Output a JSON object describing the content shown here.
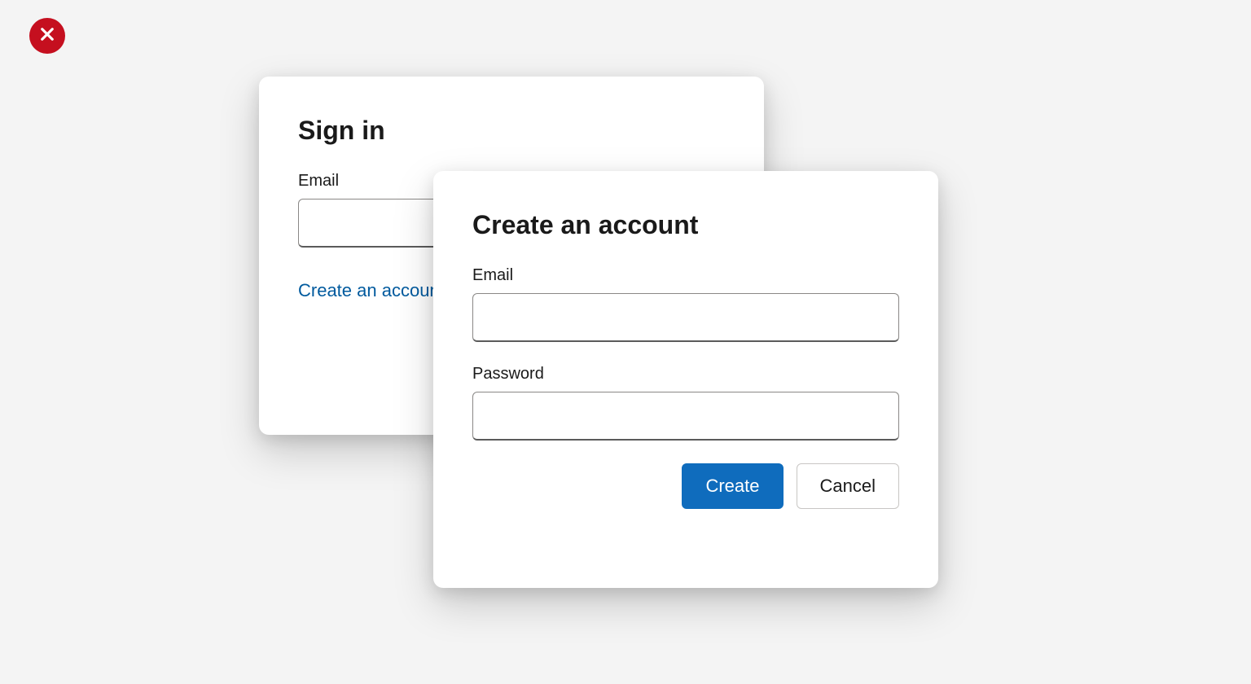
{
  "error_badge": {
    "icon": "close-icon"
  },
  "sign_in": {
    "title": "Sign in",
    "email_label": "Email",
    "email_value": "",
    "create_link": "Create an account"
  },
  "create_account": {
    "title": "Create an account",
    "email_label": "Email",
    "email_value": "",
    "password_label": "Password",
    "password_value": "",
    "create_button": "Create",
    "cancel_button": "Cancel"
  }
}
